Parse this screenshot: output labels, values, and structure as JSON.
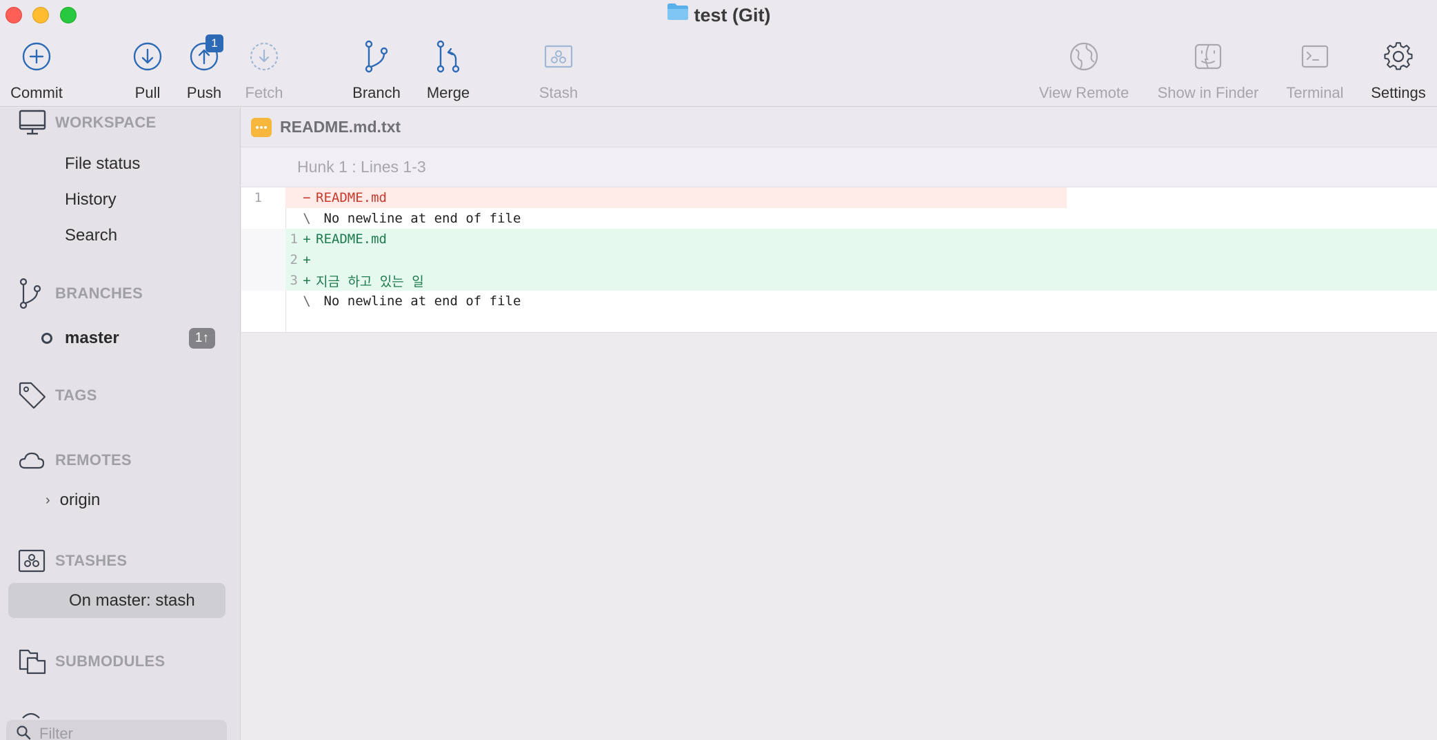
{
  "window": {
    "title": "test (Git)"
  },
  "toolbar": {
    "commit": "Commit",
    "pull": "Pull",
    "push": "Push",
    "push_badge": "1",
    "fetch": "Fetch",
    "branch": "Branch",
    "merge": "Merge",
    "stash": "Stash",
    "view_remote": "View Remote",
    "show_in_finder": "Show in Finder",
    "terminal": "Terminal",
    "settings": "Settings"
  },
  "sidebar": {
    "workspace": {
      "heading": "WORKSPACE",
      "items": [
        "File status",
        "History",
        "Search"
      ]
    },
    "branches": {
      "heading": "BRANCHES",
      "current": "master",
      "ahead": "1↑"
    },
    "tags": {
      "heading": "TAGS"
    },
    "remotes": {
      "heading": "REMOTES",
      "items": [
        "origin"
      ]
    },
    "stashes": {
      "heading": "STASHES",
      "items": [
        "On master: stash"
      ]
    },
    "submodules": {
      "heading": "SUBMODULES"
    },
    "filter_placeholder": "Filter"
  },
  "diff": {
    "file_name": "README.md.txt",
    "hunk_header": "Hunk 1 : Lines 1-3",
    "lines": [
      {
        "type": "del",
        "old": "1",
        "new": "",
        "mark": "−",
        "text": "README.md"
      },
      {
        "type": "meta",
        "old": "",
        "new": "",
        "mark": "\\",
        "text": " No newline at end of file"
      },
      {
        "type": "add",
        "old": "",
        "new": "1",
        "mark": "+",
        "text": "README.md"
      },
      {
        "type": "add",
        "old": "",
        "new": "2",
        "mark": "+",
        "text": ""
      },
      {
        "type": "add",
        "old": "",
        "new": "3",
        "mark": "+",
        "text": "지금 하고 있는 일"
      },
      {
        "type": "meta",
        "old": "",
        "new": "",
        "mark": "\\",
        "text": " No newline at end of file"
      }
    ]
  },
  "colors": {
    "accent": "#2d6ab5",
    "deleted_bg": "#ffece8",
    "added_bg": "#e6f9ee"
  }
}
